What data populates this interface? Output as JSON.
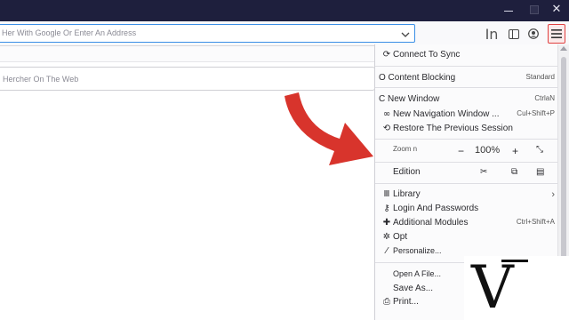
{
  "window": {
    "close_glyph": "✕"
  },
  "toolbar": {
    "url_placeholder": "Her With Google Or Enter An Address",
    "library_glyph": "In"
  },
  "content": {
    "search_placeholder": "Hercher On The Web"
  },
  "menu": {
    "items": [
      {
        "icon": "sync-icon",
        "glyph": "⟳",
        "label": "Connect To Sync"
      },
      {
        "icon": "content-blocking-icon",
        "glyph": "",
        "label": "O Content Blocking",
        "badge": "Standard"
      },
      {
        "icon": "new-window-icon",
        "glyph": "",
        "label": "C New Window",
        "shortcut": "CtrlaN"
      },
      {
        "icon": "private-window-icon",
        "glyph": "∞",
        "label": "New Navigation Window ...",
        "shortcut": "Cul+Shift+P"
      },
      {
        "icon": "restore-session-icon",
        "glyph": "⟲",
        "label": "Restore The Previous Session"
      },
      {
        "icon": "zoom-icon",
        "glyph": "",
        "label": "Zoom n",
        "minus": "−",
        "value": "100%",
        "plus": "+",
        "fullscreen": "⤡"
      },
      {
        "icon": "edit-icon",
        "glyph": "",
        "label": "Edition",
        "cut": "✂",
        "copy": "⧉",
        "paste": "▤"
      },
      {
        "icon": "library-icon",
        "glyph": "Ⅲ",
        "label": "Library",
        "arrow": "›"
      },
      {
        "icon": "key-icon",
        "glyph": "⚷",
        "label": "Login And Passwords"
      },
      {
        "icon": "puzzle-icon",
        "glyph": "✚",
        "label": "Additional Modules",
        "shortcut": "Ctrl+Shift+A"
      },
      {
        "icon": "gear-icon",
        "glyph": "✲",
        "label": "Opt"
      },
      {
        "icon": "customize-icon",
        "glyph": "⁄",
        "label": "Personalize..."
      },
      {
        "icon": "",
        "glyph": "",
        "label": "Open A File..."
      },
      {
        "icon": "",
        "glyph": "",
        "label": "Save As..."
      },
      {
        "icon": "print-icon",
        "glyph": "⎙",
        "label": "Print..."
      }
    ]
  },
  "watermark": {
    "letter": "V"
  },
  "colors": {
    "titlebar": "#1e1f3d",
    "accent": "#3a8ee6",
    "menu_highlight": "#e04040",
    "arrow": "#d8342c"
  }
}
